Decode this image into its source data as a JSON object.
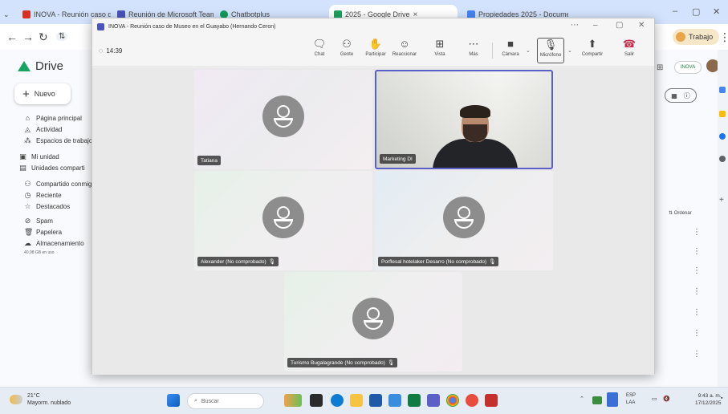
{
  "browser": {
    "tabs": [
      {
        "label": "INOVA - Reunión caso de Mu",
        "active": false
      },
      {
        "label": "Reunión de Microsoft Teams",
        "active": false
      },
      {
        "label": "Chatbotplus",
        "active": false
      },
      {
        "label": "2025 - Google Drive",
        "active": true
      },
      {
        "label": "Propiedades 2025 - Documen",
        "active": false
      }
    ],
    "profile_label": "Trabajo"
  },
  "drive": {
    "logo_text": "Drive",
    "new_button": "Nuevo",
    "nav": [
      {
        "icon": "home-icon",
        "label": "Página principal"
      },
      {
        "icon": "activity-icon",
        "label": "Actividad"
      },
      {
        "icon": "workspaces-icon",
        "label": "Espacios de trabajo"
      },
      {
        "icon": "my-drive-icon",
        "label": "Mi unidad"
      },
      {
        "icon": "shared-drives-icon",
        "label": "Unidades comparti"
      },
      {
        "icon": "shared-with-me-icon",
        "label": "Compartido conmig"
      },
      {
        "icon": "recent-icon",
        "label": "Reciente"
      },
      {
        "icon": "star-icon",
        "label": "Destacados"
      },
      {
        "icon": "spam-icon",
        "label": "Spam"
      },
      {
        "icon": "trash-icon",
        "label": "Papelera"
      },
      {
        "icon": "cloud-icon",
        "label": "Almacenamiento"
      }
    ],
    "storage_note": "40,98 GB en uso",
    "sort_label": "Ordenar"
  },
  "meeting": {
    "window_title": "INOVA - Reunión caso de Museo en el Guayabo (Hernando Ceron)",
    "timer": "14:39",
    "controls": [
      {
        "icon": "chat-icon",
        "label": "Chat"
      },
      {
        "icon": "people-icon",
        "label": "Gente"
      },
      {
        "icon": "raise-hand-icon",
        "label": "Participar"
      },
      {
        "icon": "react-icon",
        "label": "Reaccionar"
      },
      {
        "icon": "view-icon",
        "label": "Vista"
      },
      {
        "icon": "more-icon",
        "label": "Más"
      },
      {
        "icon": "camera-icon",
        "label": "Cámara"
      },
      {
        "icon": "microphone-icon",
        "label": "Micrófono"
      },
      {
        "icon": "share-icon",
        "label": "Compartir"
      },
      {
        "icon": "leave-icon",
        "label": "Salir"
      }
    ],
    "participants": [
      {
        "name": "Tatiana",
        "muted": false
      },
      {
        "name": "Marketing DI",
        "muted": false
      },
      {
        "name": "Alexander (No comprobado)",
        "muted": true
      },
      {
        "name": "Porflesal hotelaker Desarro (No comprobado)",
        "muted": true
      },
      {
        "name": "Turismo Bugalagrande (No comprobado)",
        "muted": true
      }
    ]
  },
  "taskbar": {
    "weather_temp": "21°C",
    "weather_desc": "Mayorm. nublado",
    "search_placeholder": "Buscar",
    "lang_top": "ESP",
    "lang_bottom": "LAA",
    "time": "9:43 a. m.",
    "date": "17/12/2025"
  }
}
